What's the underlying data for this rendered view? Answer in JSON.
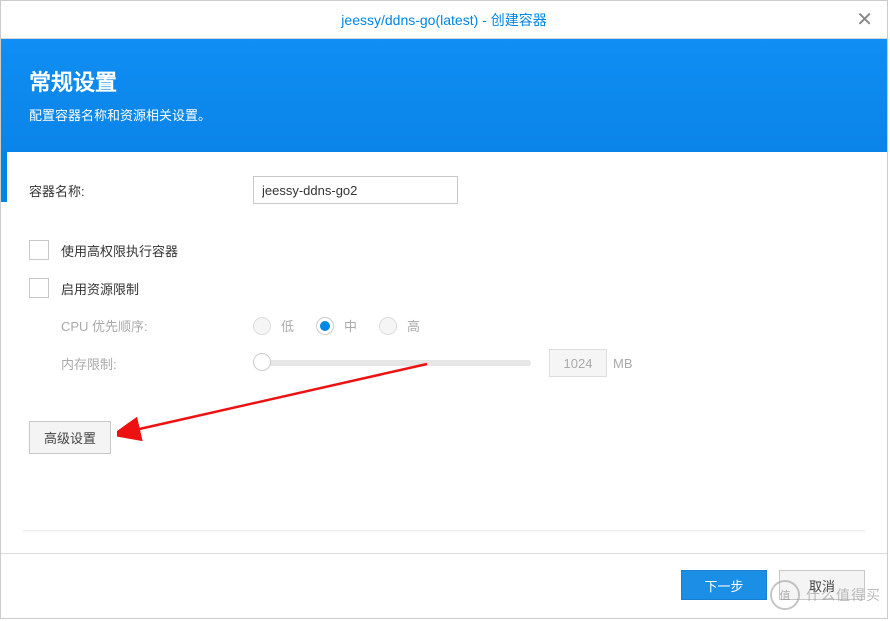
{
  "title": "jeessy/ddns-go(latest) - 创建容器",
  "banner": {
    "heading": "常规设置",
    "subheading": "配置容器名称和资源相关设置。"
  },
  "form": {
    "containerNameLabel": "容器名称:",
    "containerNameValue": "jeessy-ddns-go2",
    "highPrivLabel": "使用高权限执行容器",
    "resourceLimitLabel": "启用资源限制",
    "cpuPriorityLabel": "CPU 优先顺序:",
    "cpuOptions": {
      "low": "低",
      "mid": "中",
      "high": "高"
    },
    "cpuSelected": "mid",
    "memLimitLabel": "内存限制:",
    "memValue": "1024",
    "memUnit": "MB",
    "advancedBtn": "高级设置"
  },
  "footer": {
    "next": "下一步",
    "cancel": "取消"
  },
  "watermark": {
    "badge": "值",
    "text": "什么值得买"
  }
}
